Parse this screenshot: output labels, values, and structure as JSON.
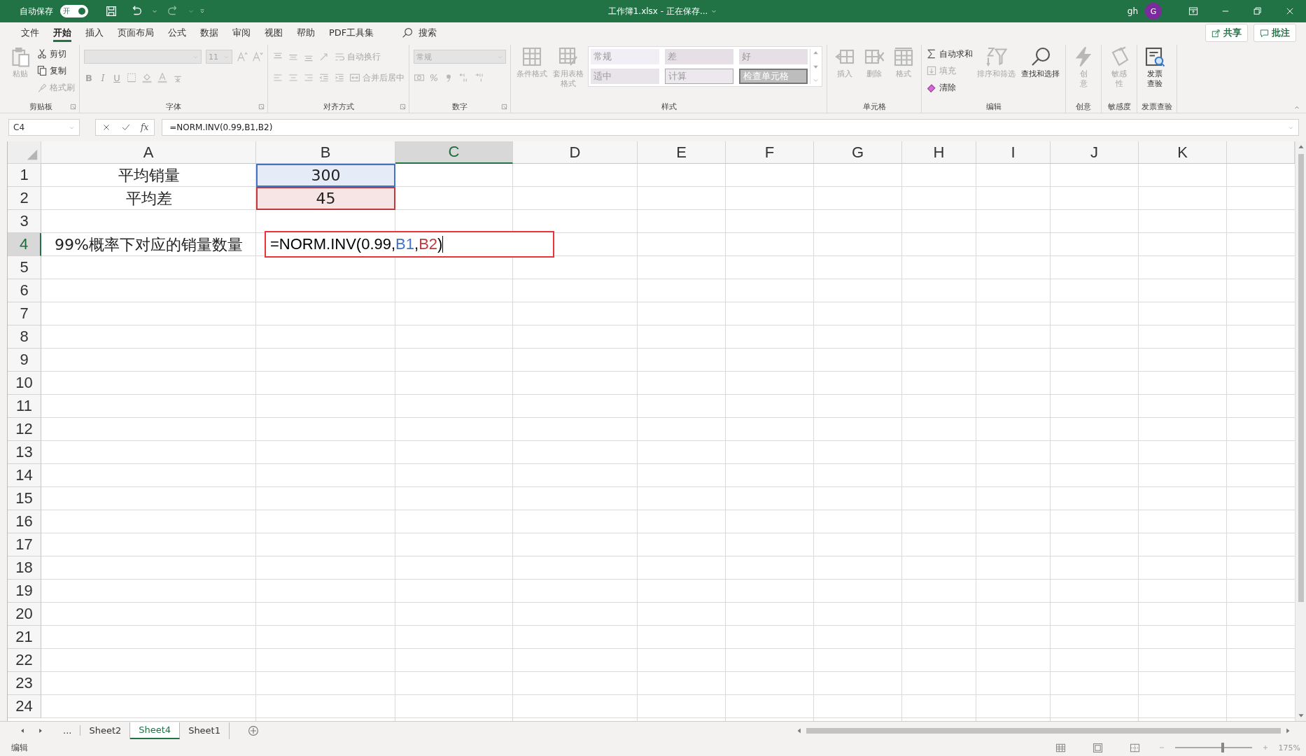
{
  "title_bar": {
    "autosave_label": "自动保存",
    "autosave_toggle": {
      "label": "开",
      "on": true
    },
    "title": "工作簿1.xlsx - 正在保存...",
    "user": "gh",
    "avatar": "G"
  },
  "menu_tabs": [
    {
      "label": "文件",
      "selected": false
    },
    {
      "label": "开始",
      "selected": true
    },
    {
      "label": "插入",
      "selected": false
    },
    {
      "label": "页面布局",
      "selected": false
    },
    {
      "label": "公式",
      "selected": false
    },
    {
      "label": "数据",
      "selected": false
    },
    {
      "label": "审阅",
      "selected": false
    },
    {
      "label": "视图",
      "selected": false
    },
    {
      "label": "帮助",
      "selected": false
    },
    {
      "label": "PDF工具集",
      "selected": false
    }
  ],
  "search": {
    "label": "搜索"
  },
  "share_button": "共享",
  "comments_button": "批注",
  "ribbon": {
    "groups": [
      {
        "label": "剪贴板",
        "launcher": true,
        "blocks": [
          {
            "kind": "big",
            "label": "粘贴",
            "disabled": true
          },
          {
            "kind": "stack",
            "rows": [
              [
                {
                  "kind": "small",
                  "label": "剪切",
                  "disabled": false
                }
              ],
              [
                {
                  "kind": "small",
                  "label": "复制",
                  "disabled": false
                }
              ],
              [
                {
                  "kind": "small",
                  "label": "格式刷",
                  "disabled": true
                }
              ]
            ]
          }
        ]
      },
      {
        "label": "字体",
        "launcher": true,
        "blocks": [
          {
            "kind": "stack",
            "rows": [
              [
                {
                  "kind": "combo",
                  "disabled": true
                },
                {
                  "kind": "combo",
                  "label": "11",
                  "disabled": true
                },
                {
                  "kind": "icon",
                  "disabled": true
                },
                {
                  "kind": "icon",
                  "disabled": true
                }
              ],
              [
                {
                  "kind": "glyph",
                  "label": "B",
                  "disabled": true
                },
                {
                  "kind": "glyph",
                  "label": "I",
                  "disabled": true
                },
                {
                  "kind": "glyph",
                  "label": "U",
                  "disabled": true
                },
                {
                  "kind": "icon",
                  "disabled": true
                },
                {
                  "kind": "icon",
                  "disabled": true
                },
                {
                  "kind": "icon",
                  "disabled": true
                },
                {
                  "kind": "icon",
                  "disabled": true
                }
              ]
            ]
          }
        ]
      },
      {
        "label": "对齐方式",
        "launcher": true,
        "blocks": [
          {
            "kind": "stack",
            "rows": [
              [
                {
                  "kind": "icon",
                  "disabled": true
                },
                {
                  "kind": "icon",
                  "disabled": true
                },
                {
                  "kind": "icon",
                  "disabled": true
                },
                {
                  "kind": "icon",
                  "disabled": true
                },
                {
                  "kind": "small",
                  "label": "自动换行",
                  "disabled": true
                }
              ],
              [
                {
                  "kind": "icon",
                  "disabled": true
                },
                {
                  "kind": "icon",
                  "disabled": true
                },
                {
                  "kind": "icon",
                  "disabled": true
                },
                {
                  "kind": "icon",
                  "disabled": true
                },
                {
                  "kind": "icon",
                  "disabled": true
                },
                {
                  "kind": "small",
                  "label": "合并后居中",
                  "disabled": true
                }
              ]
            ]
          }
        ]
      },
      {
        "label": "数字",
        "launcher": true,
        "blocks": [
          {
            "kind": "stack",
            "rows": [
              [
                {
                  "kind": "combo",
                  "label": "常规",
                  "disabled": true
                }
              ],
              [
                {
                  "kind": "icon",
                  "disabled": true
                },
                {
                  "kind": "glyph",
                  "label": "%",
                  "disabled": true
                },
                {
                  "kind": "icon",
                  "disabled": true
                },
                {
                  "kind": "icon",
                  "disabled": true
                },
                {
                  "kind": "icon",
                  "disabled": true
                }
              ]
            ]
          }
        ]
      },
      {
        "label": "样式",
        "launcher": false,
        "blocks": [
          {
            "kind": "big",
            "label": "条件格式",
            "disabled": true
          },
          {
            "kind": "big",
            "label": "套用表格格式",
            "disabled": true
          },
          {
            "kind": "gallery",
            "styles": [
              {
                "label": "常规"
              },
              {
                "label": "差"
              },
              {
                "label": "好"
              },
              {
                "label": "适中"
              },
              {
                "label": "计算"
              },
              {
                "label": "检查单元格"
              }
            ]
          }
        ]
      },
      {
        "label": "单元格",
        "launcher": false,
        "blocks": [
          {
            "kind": "big",
            "label": "插入",
            "disabled": true
          },
          {
            "kind": "big",
            "label": "删除",
            "disabled": true
          },
          {
            "kind": "big",
            "label": "格式",
            "disabled": true
          }
        ]
      },
      {
        "label": "编辑",
        "launcher": false,
        "blocks": [
          {
            "kind": "stack",
            "rows": [
              [
                {
                  "kind": "small",
                  "label": "自动求和",
                  "disabled": false
                }
              ],
              [
                {
                  "kind": "small",
                  "label": "填充",
                  "disabled": true
                }
              ],
              [
                {
                  "kind": "small",
                  "label": "清除",
                  "disabled": false
                }
              ]
            ]
          },
          {
            "kind": "big",
            "label": "排序和筛选",
            "disabled": true
          },
          {
            "kind": "big",
            "label": "查找和选择",
            "disabled": false
          }
        ]
      },
      {
        "label": "创意",
        "launcher": false,
        "blocks": [
          {
            "kind": "big",
            "label": "创意",
            "disabled": true
          }
        ]
      },
      {
        "label": "敏感度",
        "launcher": false,
        "blocks": [
          {
            "kind": "big",
            "label": "敏感性",
            "disabled": true
          }
        ]
      },
      {
        "label": "发票查验",
        "launcher": false,
        "blocks": [
          {
            "kind": "big",
            "label": "发票查验",
            "disabled": false
          }
        ]
      }
    ]
  },
  "formula_bar": {
    "name_box": "C4",
    "fx": "fx",
    "formula": "=NORM.INV(0.99,B1,B2)"
  },
  "sheet": {
    "columns": [
      {
        "label": "A",
        "selected": false
      },
      {
        "label": "B",
        "selected": false
      },
      {
        "label": "C",
        "selected": true
      },
      {
        "label": "D",
        "selected": false
      },
      {
        "label": "E",
        "selected": false
      },
      {
        "label": "F",
        "selected": false
      },
      {
        "label": "G",
        "selected": false
      },
      {
        "label": "H",
        "selected": false
      },
      {
        "label": "I",
        "selected": false
      },
      {
        "label": "J",
        "selected": false
      },
      {
        "label": "K",
        "selected": false
      }
    ],
    "rows": [
      {
        "label": "1",
        "selected": false,
        "cells": [
          {
            "text": "平均销量"
          },
          {
            "text": "300",
            "color": "#4472c4"
          }
        ]
      },
      {
        "label": "2",
        "selected": false,
        "cells": [
          {
            "text": "平均差"
          },
          {
            "text": "45",
            "color": "#c0393b"
          }
        ]
      },
      {
        "label": "3",
        "selected": false
      },
      {
        "label": "4",
        "selected": true,
        "cells": [
          {
            "text": "99%概率下对应的销量数量"
          }
        ],
        "editor": {
          "annotated": true,
          "segments": [
            {
              "text": "=NORM.INV(0.99,",
              "color": "#000000"
            },
            {
              "text": "B1",
              "color": "#4472c4"
            },
            {
              "text": ",",
              "color": "#000000"
            },
            {
              "text": "B2",
              "color": "#c0393b"
            },
            {
              "text": ")",
              "color": "#000000"
            }
          ]
        }
      },
      {
        "label": "5",
        "selected": false
      },
      {
        "label": "6",
        "selected": false
      },
      {
        "label": "7",
        "selected": false
      },
      {
        "label": "8",
        "selected": false
      },
      {
        "label": "9",
        "selected": false
      },
      {
        "label": "10",
        "selected": false
      },
      {
        "label": "11",
        "selected": false
      },
      {
        "label": "12",
        "selected": false
      },
      {
        "label": "13",
        "selected": false
      },
      {
        "label": "14",
        "selected": false
      },
      {
        "label": "15",
        "selected": false
      },
      {
        "label": "16",
        "selected": false
      },
      {
        "label": "17",
        "selected": false
      },
      {
        "label": "18",
        "selected": false
      },
      {
        "label": "19",
        "selected": false
      },
      {
        "label": "20",
        "selected": false
      },
      {
        "label": "21",
        "selected": false
      },
      {
        "label": "22",
        "selected": false
      },
      {
        "label": "23",
        "selected": false
      },
      {
        "label": "24",
        "selected": false
      }
    ]
  },
  "sheet_tabs": {
    "more": "...",
    "tabs": [
      {
        "label": "Sheet2",
        "selected": false
      },
      {
        "label": "Sheet4",
        "selected": true
      },
      {
        "label": "Sheet1",
        "selected": false
      }
    ]
  },
  "status_bar": {
    "mode": "编辑",
    "zoom": {
      "level": 0.6,
      "label": "175%"
    }
  }
}
